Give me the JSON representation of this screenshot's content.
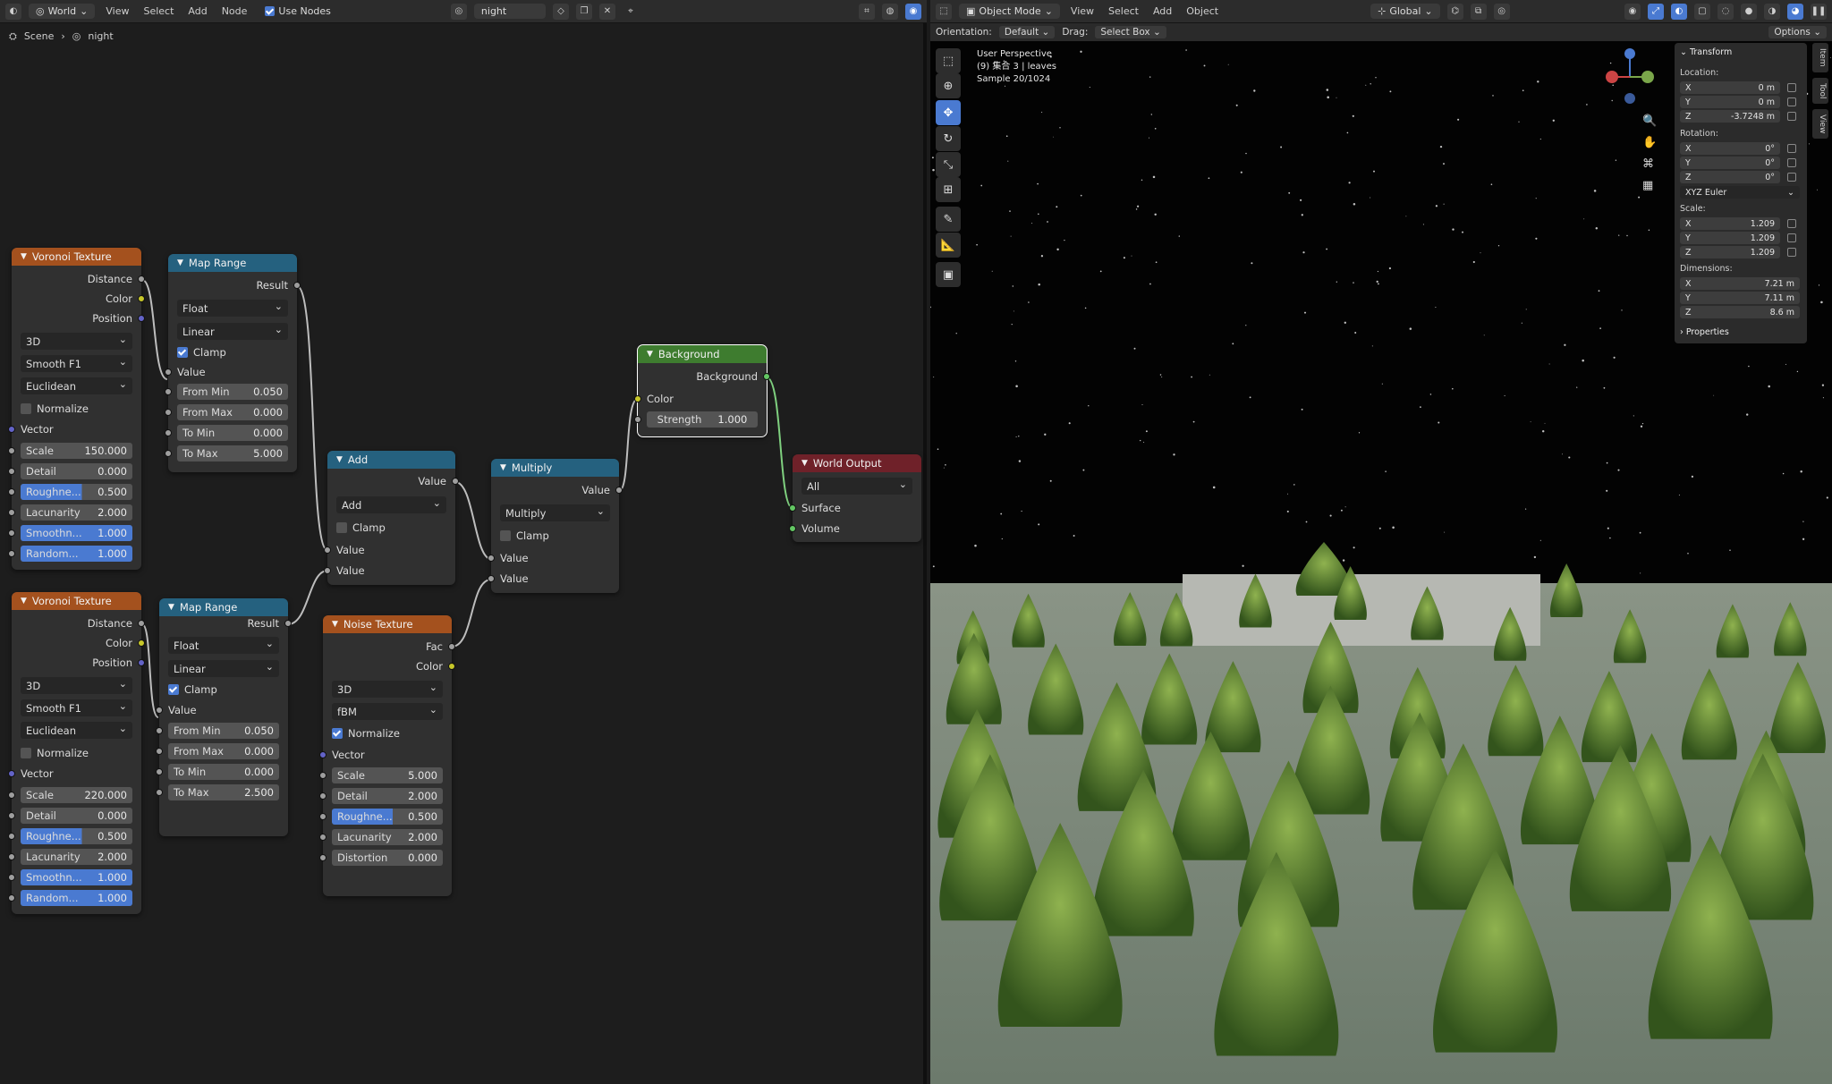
{
  "node_header": {
    "editor_type_icon": "world-icon",
    "world_label": "World",
    "menus": [
      "View",
      "Select",
      "Add",
      "Node"
    ],
    "use_nodes_label": "Use Nodes",
    "world_name": "night"
  },
  "breadcrumb": {
    "scene": "Scene",
    "world": "night"
  },
  "nodes": {
    "voronoi1": {
      "title": "Voronoi Texture",
      "outputs": [
        "Distance",
        "Color",
        "Position"
      ],
      "dims": "3D",
      "feature": "Smooth F1",
      "metric": "Euclidean",
      "normalize_label": "Normalize",
      "vector_label": "Vector",
      "fields": [
        {
          "label": "Scale",
          "value": "150.000"
        },
        {
          "label": "Detail",
          "value": "0.000"
        },
        {
          "label": "Roughne...",
          "value": "0.500"
        },
        {
          "label": "Lacunarity",
          "value": "2.000"
        },
        {
          "label": "Smoothn...",
          "value": "1.000"
        },
        {
          "label": "Random...",
          "value": "1.000"
        }
      ]
    },
    "voronoi2": {
      "title": "Voronoi Texture",
      "outputs": [
        "Distance",
        "Color",
        "Position"
      ],
      "dims": "3D",
      "feature": "Smooth F1",
      "metric": "Euclidean",
      "normalize_label": "Normalize",
      "vector_label": "Vector",
      "fields": [
        {
          "label": "Scale",
          "value": "220.000"
        },
        {
          "label": "Detail",
          "value": "0.000"
        },
        {
          "label": "Roughne...",
          "value": "0.500"
        },
        {
          "label": "Lacunarity",
          "value": "2.000"
        },
        {
          "label": "Smoothn...",
          "value": "1.000"
        },
        {
          "label": "Random...",
          "value": "1.000"
        }
      ]
    },
    "maprange1": {
      "title": "Map Range",
      "output": "Result",
      "type": "Float",
      "interp": "Linear",
      "clamp_label": "Clamp",
      "value_label": "Value",
      "fields": [
        {
          "label": "From Min",
          "value": "0.050"
        },
        {
          "label": "From Max",
          "value": "0.000"
        },
        {
          "label": "To Min",
          "value": "0.000"
        },
        {
          "label": "To Max",
          "value": "5.000"
        }
      ]
    },
    "maprange2": {
      "title": "Map Range",
      "output": "Result",
      "type": "Float",
      "interp": "Linear",
      "clamp_label": "Clamp",
      "value_label": "Value",
      "fields": [
        {
          "label": "From Min",
          "value": "0.050"
        },
        {
          "label": "From Max",
          "value": "0.000"
        },
        {
          "label": "To Min",
          "value": "0.000"
        },
        {
          "label": "To Max",
          "value": "2.500"
        }
      ]
    },
    "add": {
      "title": "Add",
      "output": "Value",
      "op": "Add",
      "clamp_label": "Clamp",
      "inputs": [
        "Value",
        "Value"
      ]
    },
    "multiply": {
      "title": "Multiply",
      "output": "Value",
      "op": "Multiply",
      "clamp_label": "Clamp",
      "inputs": [
        "Value",
        "Value"
      ]
    },
    "noise": {
      "title": "Noise Texture",
      "outputs": [
        "Fac",
        "Color"
      ],
      "dims": "3D",
      "type": "fBM",
      "normalize_label": "Normalize",
      "vector_label": "Vector",
      "fields": [
        {
          "label": "Scale",
          "value": "5.000"
        },
        {
          "label": "Detail",
          "value": "2.000"
        },
        {
          "label": "Roughne...",
          "value": "0.500"
        },
        {
          "label": "Lacunarity",
          "value": "2.000"
        },
        {
          "label": "Distortion",
          "value": "0.000"
        }
      ]
    },
    "background": {
      "title": "Background",
      "output": "Background",
      "color_label": "Color",
      "strength_label": "Strength",
      "strength": "1.000"
    },
    "world_output": {
      "title": "World Output",
      "target": "All",
      "inputs": [
        "Surface",
        "Volume"
      ]
    }
  },
  "viewport": {
    "mode": "Object Mode",
    "menus": [
      "View",
      "Select",
      "Add",
      "Object"
    ],
    "orientation_label": "Orientation:",
    "orientation": "Default",
    "drag_label": "Drag:",
    "drag": "Select Box",
    "transform_space": "Global",
    "options_label": "Options",
    "overlay": {
      "line1": "User Perspective",
      "line2": "(9) 集合 3 | leaves",
      "line3": "Sample 20/1024"
    }
  },
  "n_panel": {
    "title": "Transform",
    "location_label": "Location:",
    "location": [
      {
        "axis": "X",
        "value": "0 m"
      },
      {
        "axis": "Y",
        "value": "0 m"
      },
      {
        "axis": "Z",
        "value": "-3.7248 m"
      }
    ],
    "rotation_label": "Rotation:",
    "rotation": [
      {
        "axis": "X",
        "value": "0°"
      },
      {
        "axis": "Y",
        "value": "0°"
      },
      {
        "axis": "Z",
        "value": "0°"
      }
    ],
    "rotation_mode": "XYZ Euler",
    "scale_label": "Scale:",
    "scale": [
      {
        "axis": "X",
        "value": "1.209"
      },
      {
        "axis": "Y",
        "value": "1.209"
      },
      {
        "axis": "Z",
        "value": "1.209"
      }
    ],
    "dimensions_label": "Dimensions:",
    "dimensions": [
      {
        "axis": "X",
        "value": "7.21 m"
      },
      {
        "axis": "Y",
        "value": "7.11 m"
      },
      {
        "axis": "Z",
        "value": "8.6 m"
      }
    ],
    "properties_label": "Properties",
    "side_tabs": [
      "Item",
      "Tool",
      "View"
    ]
  },
  "colors": {
    "voronoi_header": "#a4511e",
    "map_range_header": "#25617f",
    "background_header": "#3e7c2f",
    "world_output_header": "#6f2129",
    "accent": "#4a7ad1"
  }
}
